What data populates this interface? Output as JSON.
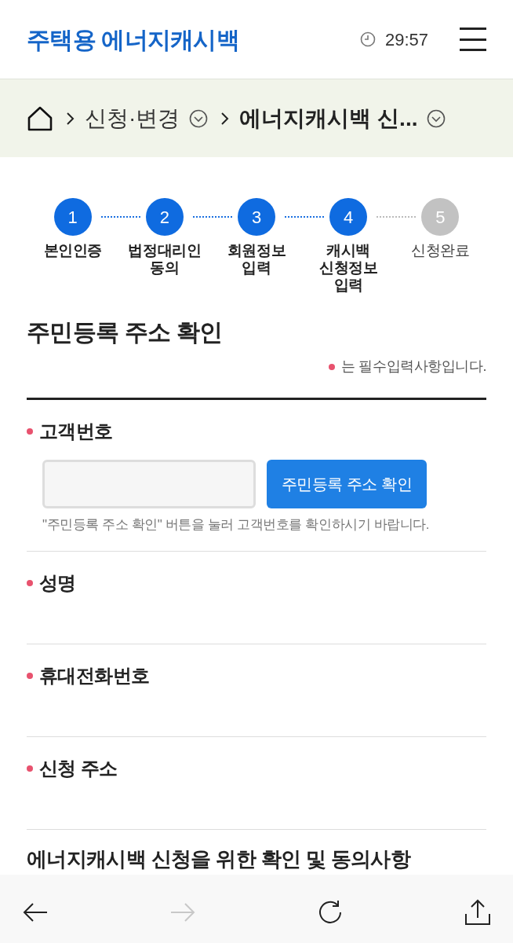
{
  "header": {
    "logo": "주택용 에너지캐시백",
    "timer": "29:57"
  },
  "breadcrumb": [
    {
      "label": "신청·변경",
      "current": false
    },
    {
      "label": "에너지캐시백 신...",
      "current": true
    }
  ],
  "steps": [
    {
      "number": "1",
      "label": "본인인증",
      "done": true
    },
    {
      "number": "2",
      "label": "법정대리인\n동의",
      "done": true
    },
    {
      "number": "3",
      "label": "회원정보\n입력",
      "done": true
    },
    {
      "number": "4",
      "label": "캐시백\n신청정보\n입력",
      "done": true
    },
    {
      "number": "5",
      "label": "신청완료",
      "done": false
    }
  ],
  "section": {
    "title": "주민등록 주소 확인",
    "required_note": "는 필수입력사항입니다."
  },
  "fields": [
    {
      "kind": "input_button",
      "label": "고객번호",
      "required": true,
      "button": "주민등록 주소 확인",
      "help": "\"주민등록 주소 확인\" 버튼을 눌러 고객번호를 확인하시기 바랍니다."
    },
    {
      "kind": "text",
      "label": "성명",
      "required": true
    },
    {
      "kind": "text",
      "label": "휴대전화번호",
      "required": true
    },
    {
      "kind": "text",
      "label": "신청 주소",
      "required": true
    }
  ],
  "next_section": {
    "title": "에너지캐시백 신청을 위한 확인 및 동의사항"
  },
  "toolbar": {
    "forward_disabled": true
  }
}
